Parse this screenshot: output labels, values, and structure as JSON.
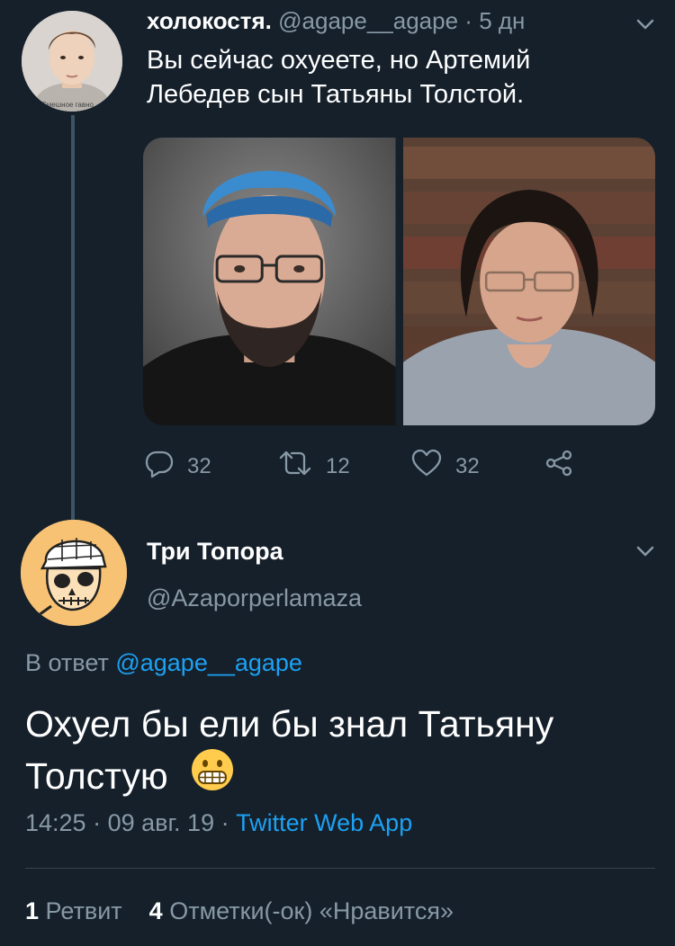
{
  "parent_tweet": {
    "display_name": "холокостя.",
    "handle": "@agape__agape",
    "separator": "·",
    "time": "5 дн",
    "text": "Вы сейчас охуеете, но Артемий Лебедев сын Татьяны Толстой.",
    "avatar_caption": "Смешное гавно",
    "reply_count": "32",
    "retweet_count": "12",
    "like_count": "32"
  },
  "reply_tweet": {
    "display_name": "Три Топора",
    "handle": "@Azaporperlamaza",
    "reply_prefix": "В ответ",
    "reply_to_handle": "@agape__agape",
    "text": "Охуел бы ели бы знал Татьяну Толстую",
    "emoji": "grimacing-face",
    "time": "14:25",
    "date": "09 авг. 19",
    "source": "Twitter Web App",
    "separator": "·",
    "retweet_count": "1",
    "retweet_label": "Ретвит",
    "like_count": "4",
    "like_label": "Отметки(-ок) «Нравится»"
  },
  "colors": {
    "background": "#15202b",
    "text": "#ffffff",
    "muted": "#8899a6",
    "link": "#1da1f2",
    "divider": "#38444d",
    "thread_line": "#3d5466"
  }
}
